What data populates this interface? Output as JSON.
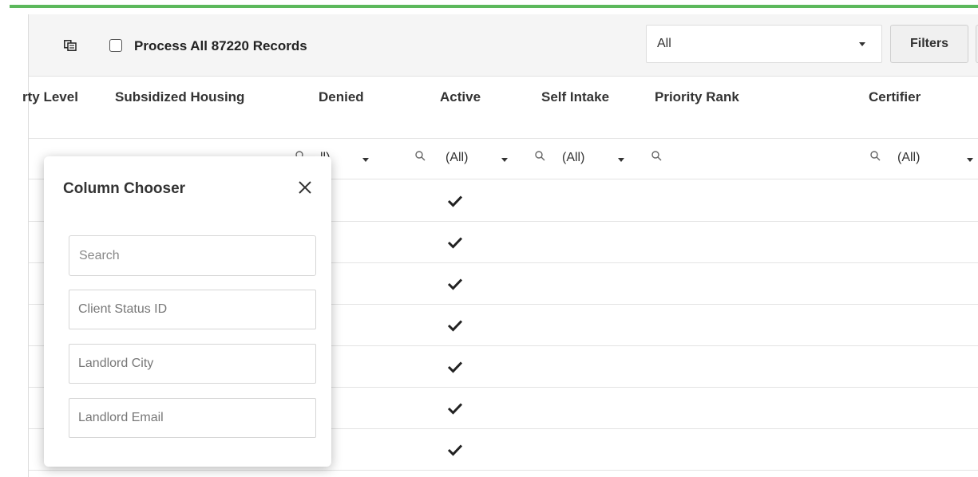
{
  "toolbar": {
    "process_all_label": "Process All 87220 Records",
    "select_value": "All",
    "filters_label": "Filters"
  },
  "columns": [
    {
      "label": "rty Level"
    },
    {
      "label": "Subsidized Housing"
    },
    {
      "label": "Denied"
    },
    {
      "label": "Active"
    },
    {
      "label": "Self Intake"
    },
    {
      "label": "Priority Rank"
    },
    {
      "label": "Certifier"
    }
  ],
  "filter_row": {
    "all_text": "(All)",
    "partial_text": "ll)"
  },
  "rows": [
    {
      "active": true
    },
    {
      "active": true
    },
    {
      "active": true
    },
    {
      "active": true
    },
    {
      "active": true
    },
    {
      "active": true
    },
    {
      "active": true
    }
  ],
  "column_chooser": {
    "title": "Column Chooser",
    "search_placeholder": "Search",
    "items": [
      "Client Status ID",
      "Landlord City",
      "Landlord Email"
    ]
  },
  "colors": {
    "accent_green": "#5cb85c",
    "toolbar_bg": "#f5f5f5",
    "border": "#e3e3e3"
  },
  "icons": [
    "column-chooser-icon",
    "search-icon",
    "chevron-down-icon",
    "checkmark-icon",
    "close-icon"
  ]
}
